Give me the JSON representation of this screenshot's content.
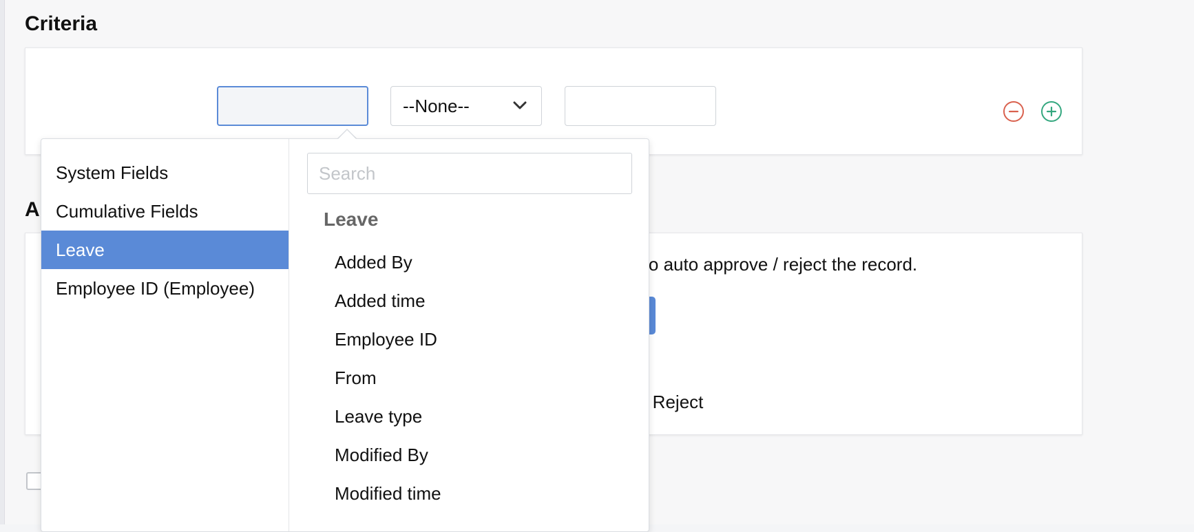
{
  "criteria": {
    "title": "Criteria",
    "operator_value": "--None--",
    "remove_icon": "minus-circle-icon",
    "add_icon": "plus-circle-icon",
    "remove_color": "#d9614e",
    "add_color": "#34a77f"
  },
  "actions": {
    "title_partial": "A",
    "description_partial": "n to auto approve / reject the record.",
    "reject_partial": "o Reject"
  },
  "dropdown": {
    "categories": [
      {
        "label": "System Fields",
        "active": false
      },
      {
        "label": "Cumulative Fields",
        "active": false
      },
      {
        "label": "Leave",
        "active": true
      },
      {
        "label": "Employee ID (Employee)",
        "active": false
      }
    ],
    "search_placeholder": "Search",
    "group_label": "Leave",
    "fields": [
      "Added By",
      "Added time",
      "Employee ID",
      "From",
      "Leave type",
      "Modified By",
      "Modified time"
    ]
  },
  "colors": {
    "accent": "#5a8ad7"
  }
}
